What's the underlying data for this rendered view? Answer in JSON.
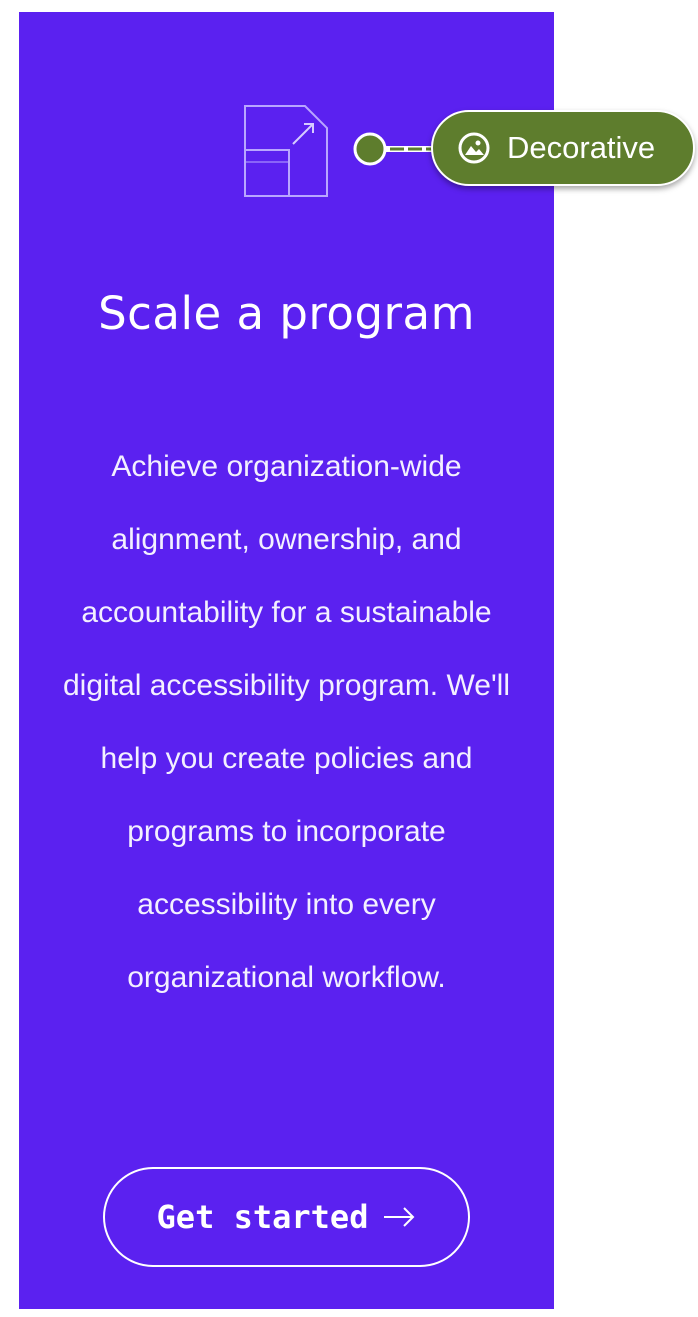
{
  "colors": {
    "card_background": "#5b21f0",
    "text": "#ffffff",
    "tag_background": "#5e7d2d"
  },
  "card": {
    "icon": "scale-program-icon",
    "title": "Scale a program",
    "body": "Achieve organization-wide alignment, ownership, and accountability for a sustainable digital accessibility program. We'll help you create policies and programs to incorporate accessibility into every organizational workflow.",
    "cta": {
      "label": "Get started",
      "icon": "arrow-right-icon"
    }
  },
  "annotation": {
    "icon": "image-icon",
    "label": "Decorative"
  }
}
